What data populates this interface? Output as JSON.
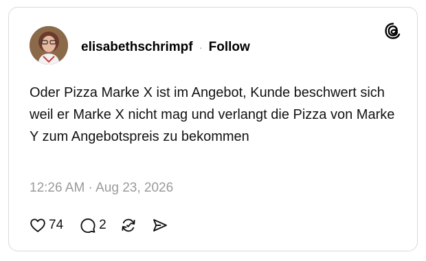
{
  "post": {
    "username": "elisabethschrimpf",
    "separator": "·",
    "follow_label": "Follow",
    "text": "Oder Pizza Marke X ist im Angebot, Kunde beschwert sich weil er Marke X nicht mag und verlangt die Pizza von Marke Y zum Angebotspreis zu bekommen",
    "timestamp": "12:26 AM · Aug 23, 2026",
    "likes": "74",
    "replies": "2"
  },
  "icons": {
    "brand": "threads-logo-icon",
    "like": "heart-icon",
    "reply": "comment-icon",
    "repost": "repost-icon",
    "share": "send-icon"
  }
}
